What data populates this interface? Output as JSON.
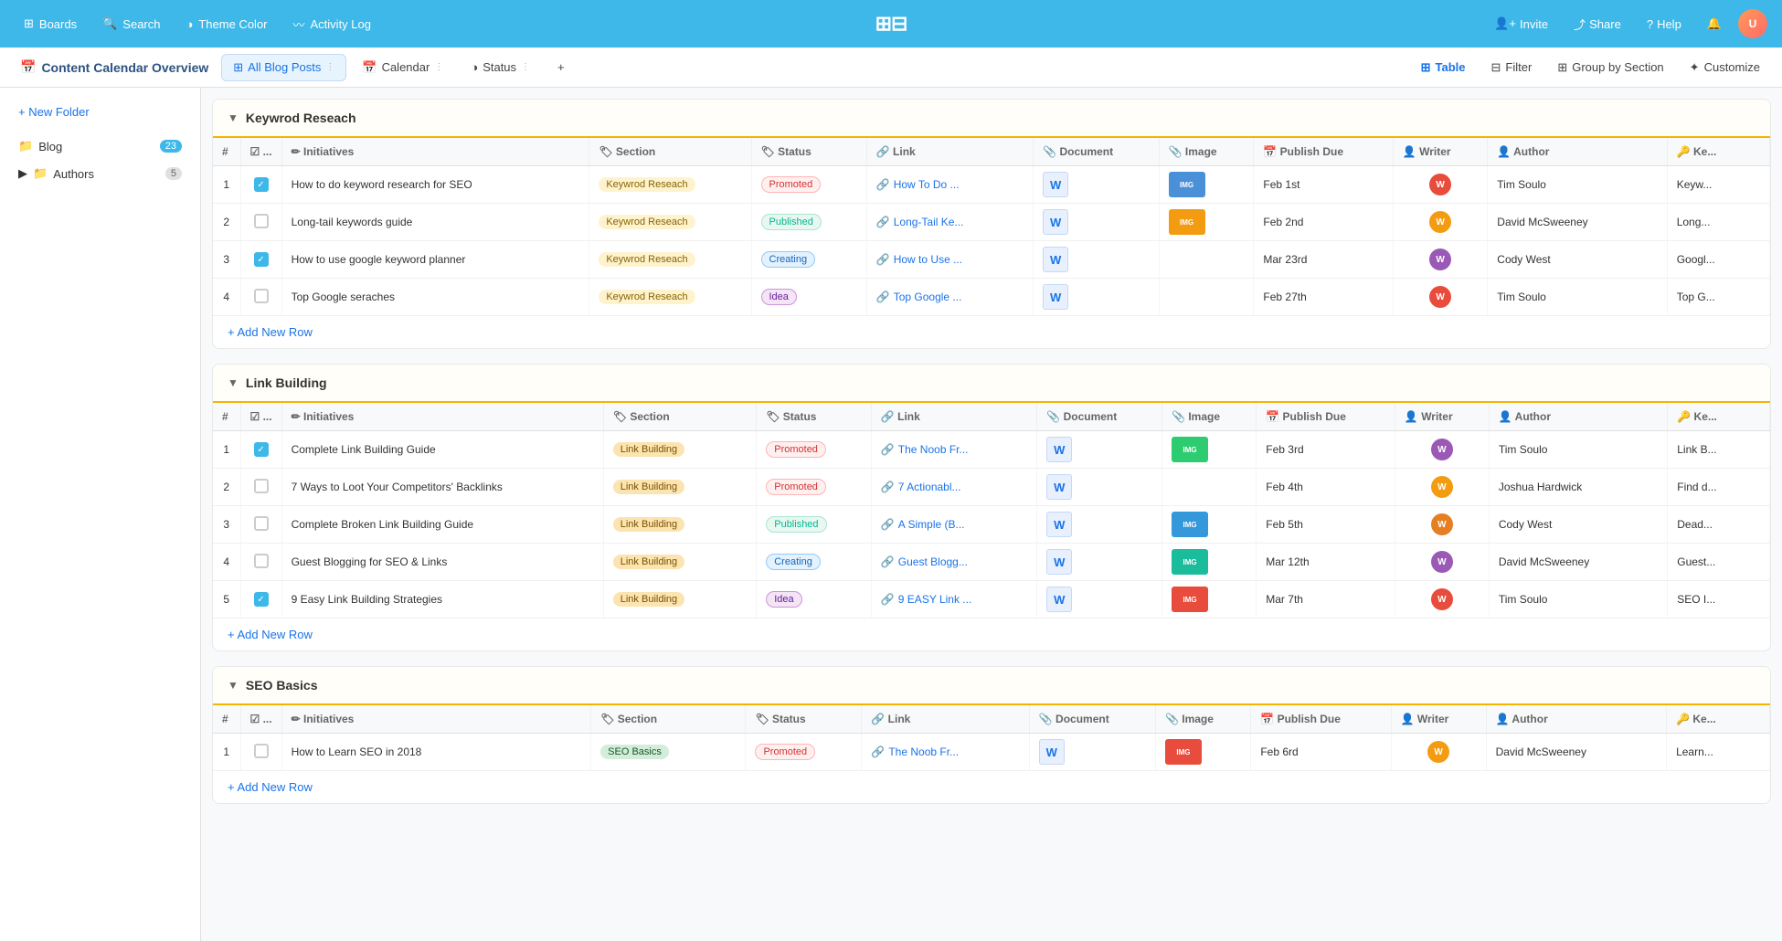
{
  "nav": {
    "boards": "Boards",
    "search": "Search",
    "themeColor": "Theme Color",
    "activityLog": "Activity Log",
    "logo": "⊞",
    "invite": "Invite",
    "share": "Share",
    "help": "Help"
  },
  "subNav": {
    "title": "Content Calendar Overview",
    "tabs": [
      {
        "label": "All Blog Posts",
        "active": true
      },
      {
        "label": "Calendar",
        "active": false
      },
      {
        "label": "Status",
        "active": false
      }
    ]
  },
  "toolbar": {
    "table": "Table",
    "filter": "Filter",
    "groupBySection": "Group by Section",
    "customize": "Customize"
  },
  "sidebar": {
    "newFolder": "+ New Folder",
    "items": [
      {
        "label": "Blog",
        "count": "23",
        "icon": "folder"
      },
      {
        "label": "Authors",
        "count": "5",
        "icon": "folder"
      }
    ]
  },
  "sections": [
    {
      "name": "Keywrod Reseach",
      "addRow": "+ Add New Row",
      "columns": [
        "#",
        "",
        "Initiatives",
        "Section",
        "Status",
        "Link",
        "Document",
        "Image",
        "Publish Due",
        "Writer",
        "Author",
        "Ke..."
      ],
      "rows": [
        {
          "num": "1",
          "checked": true,
          "initiative": "How to do keyword research for SEO",
          "section": "Keywrod Reseach",
          "sectionClass": "tag-keyword",
          "status": "Promoted",
          "statusClass": "status-promoted",
          "link": "How To Do ...",
          "doc": "W",
          "imageColor": "#4a90d9",
          "publishDue": "Feb 1st",
          "writerColor": "#e74c3c",
          "author": "Tim Soulo",
          "key": "Keyw..."
        },
        {
          "num": "2",
          "checked": false,
          "initiative": "Long-tail keywords guide",
          "section": "Keywrod Reseach",
          "sectionClass": "tag-keyword",
          "status": "Published",
          "statusClass": "status-published",
          "link": "Long-Tail Ke...",
          "doc": "W",
          "imageColor": "#f39c12",
          "publishDue": "Feb 2nd",
          "writerColor": "#f39c12",
          "author": "David McSweeney",
          "key": "Long..."
        },
        {
          "num": "3",
          "checked": true,
          "initiative": "How to use google keyword planner",
          "section": "Keywrod Reseach",
          "sectionClass": "tag-keyword",
          "status": "Creating",
          "statusClass": "status-creating",
          "link": "How to Use ...",
          "doc": "W",
          "imageColor": "",
          "publishDue": "Mar 23rd",
          "writerColor": "#9b59b6",
          "author": "Cody West",
          "key": "Googl..."
        },
        {
          "num": "4",
          "checked": false,
          "initiative": "Top Google seraches",
          "section": "Keywrod Reseach",
          "sectionClass": "tag-keyword",
          "status": "Idea",
          "statusClass": "status-idea",
          "link": "Top Google ...",
          "doc": "W",
          "imageColor": "",
          "publishDue": "Feb 27th",
          "writerColor": "#e74c3c",
          "author": "Tim Soulo",
          "key": "Top G..."
        }
      ]
    },
    {
      "name": "Link Building",
      "addRow": "+ Add New Row",
      "columns": [
        "#",
        "",
        "Initiatives",
        "Section",
        "Status",
        "Link",
        "Document",
        "Image",
        "Publish Due",
        "Writer",
        "Author",
        "Ke..."
      ],
      "rows": [
        {
          "num": "1",
          "checked": true,
          "initiative": "Complete Link Building Guide",
          "section": "Link Building",
          "sectionClass": "tag-link",
          "status": "Promoted",
          "statusClass": "status-promoted",
          "link": "The Noob Fr...",
          "doc": "W",
          "imageColor": "#2ecc71",
          "publishDue": "Feb 3rd",
          "writerColor": "#9b59b6",
          "author": "Tim Soulo",
          "key": "Link B..."
        },
        {
          "num": "2",
          "checked": false,
          "initiative": "7 Ways to Loot Your Competitors' Backlinks",
          "section": "Link Building",
          "sectionClass": "tag-link",
          "status": "Promoted",
          "statusClass": "status-promoted",
          "link": "7 Actionabl...",
          "doc": "W",
          "imageColor": "",
          "publishDue": "Feb 4th",
          "writerColor": "#f39c12",
          "author": "Joshua Hardwick",
          "key": "Find d..."
        },
        {
          "num": "3",
          "checked": false,
          "initiative": "Complete Broken Link Building Guide",
          "section": "Link Building",
          "sectionClass": "tag-link",
          "status": "Published",
          "statusClass": "status-published",
          "link": "A Simple (B...",
          "doc": "W",
          "imageColor": "#3498db",
          "publishDue": "Feb 5th",
          "writerColor": "#e67e22",
          "author": "Cody West",
          "key": "Dead..."
        },
        {
          "num": "4",
          "checked": false,
          "initiative": "Guest Blogging for SEO & Links",
          "section": "Link Building",
          "sectionClass": "tag-link",
          "status": "Creating",
          "statusClass": "status-creating",
          "link": "Guest Blogg...",
          "doc": "W",
          "imageColor": "#1abc9c",
          "publishDue": "Mar 12th",
          "writerColor": "#9b59b6",
          "author": "David McSweeney",
          "key": "Guest..."
        },
        {
          "num": "5",
          "checked": true,
          "initiative": "9 Easy Link Building Strategies",
          "section": "Link Building",
          "sectionClass": "tag-link",
          "status": "Idea",
          "statusClass": "status-idea",
          "link": "9 EASY Link ...",
          "doc": "W",
          "imageColor": "#e74c3c",
          "publishDue": "Mar 7th",
          "writerColor": "#e74c3c",
          "author": "Tim Soulo",
          "key": "SEO I..."
        }
      ]
    },
    {
      "name": "SEO Basics",
      "addRow": "+ Add New Row",
      "columns": [
        "#",
        "",
        "Initiatives",
        "Section",
        "Status",
        "Link",
        "Document",
        "Image",
        "Publish Due",
        "Writer",
        "Author",
        "Ke..."
      ],
      "rows": [
        {
          "num": "1",
          "checked": false,
          "initiative": "How to Learn SEO in 2018",
          "section": "SEO Basics",
          "sectionClass": "tag-seo",
          "status": "Promoted",
          "statusClass": "status-promoted",
          "link": "The Noob Fr...",
          "doc": "W",
          "imageColor": "#e74c3c",
          "publishDue": "Feb 6rd",
          "writerColor": "#f39c12",
          "author": "David McSweeney",
          "key": "Learn..."
        }
      ]
    }
  ]
}
